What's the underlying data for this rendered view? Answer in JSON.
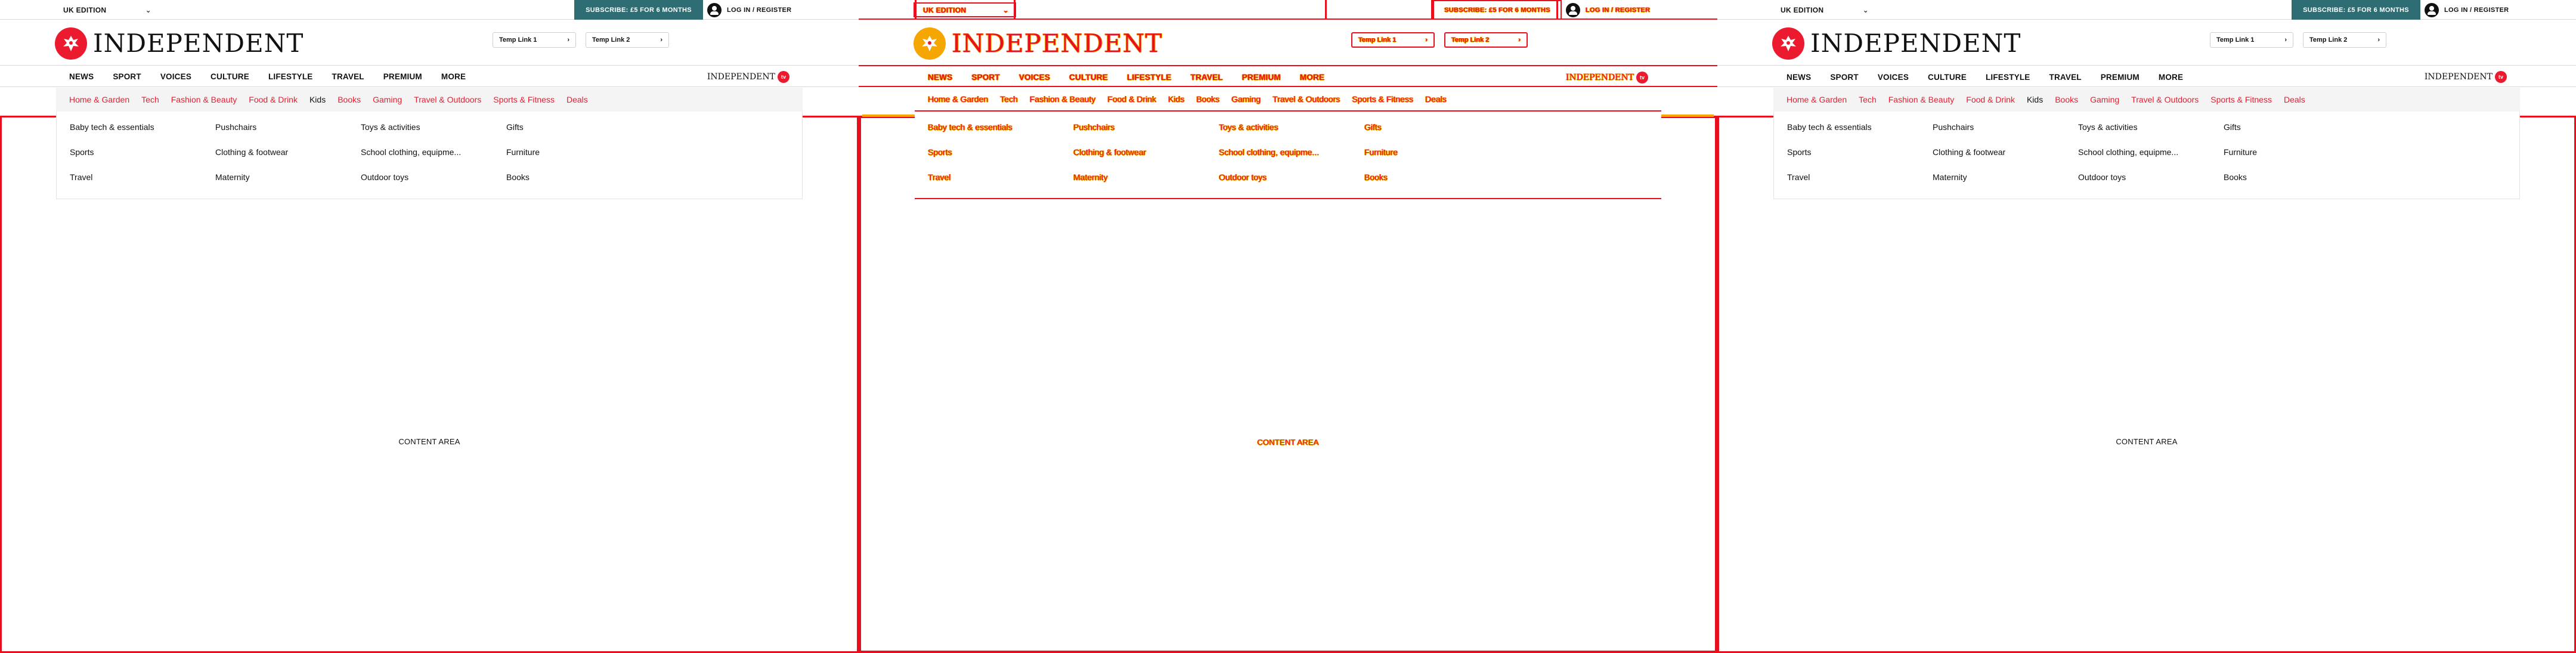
{
  "topbar": {
    "edition_label": "UK EDITION",
    "subscribe_label": "SUBSCRIBE: £5 FOR 6 MONTHS",
    "login_label": "LOG IN / REGISTER"
  },
  "header": {
    "logo_text": "INDEPENDENT",
    "temp_links": [
      "Temp Link 1",
      "Temp Link 2"
    ]
  },
  "nav": {
    "items": [
      "NEWS",
      "SPORT",
      "VOICES",
      "CULTURE",
      "LIFESTYLE",
      "TRAVEL",
      "PREMIUM",
      "MORE"
    ],
    "brand_logo_text": "INDEPENDENT",
    "brand_logo_badge": "tv"
  },
  "subnav": {
    "items": [
      {
        "label": "Home & Garden",
        "active": false
      },
      {
        "label": "Tech",
        "active": false
      },
      {
        "label": "Fashion & Beauty",
        "active": false
      },
      {
        "label": "Food & Drink",
        "active": false
      },
      {
        "label": "Kids",
        "active": true
      },
      {
        "label": "Books",
        "active": false
      },
      {
        "label": "Gaming",
        "active": false
      },
      {
        "label": "Travel & Outdoors",
        "active": false
      },
      {
        "label": "Sports & Fitness",
        "active": false
      },
      {
        "label": "Deals",
        "active": false
      }
    ]
  },
  "dropdown": {
    "columns": [
      [
        "Baby tech & essentials",
        "Sports",
        "Travel"
      ],
      [
        "Pushchairs",
        "Clothing & footwear",
        "Maternity"
      ],
      [
        "Toys & activities",
        "School clothing, equipme...",
        "Outdoor toys"
      ],
      [
        "Gifts",
        "Furniture",
        "Books"
      ]
    ]
  },
  "content": {
    "label": "CONTENT AREA"
  },
  "colors": {
    "brand_red": "#ec1a2e",
    "subscribe_teal": "#2f6d74",
    "diff_red": "#e8101f",
    "diff_orange": "#f6a600",
    "subnav_bg": "#f4f4f4"
  },
  "icons": [
    "chevron-down-icon",
    "user-icon",
    "chevron-right-icon",
    "eagle-icon"
  ]
}
